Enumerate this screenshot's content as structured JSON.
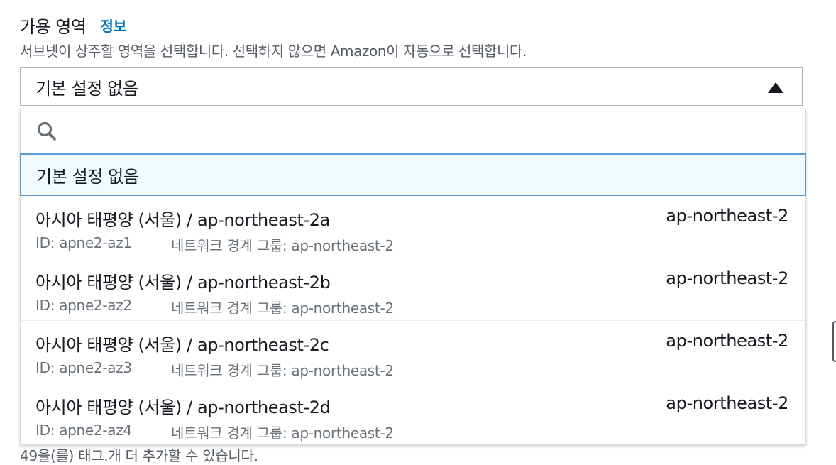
{
  "field": {
    "label": "가용 영역",
    "info_link": "정보",
    "description": "서브넷이 상주할 영역을 선택합니다. 선택하지 않으면 Amazon이 자동으로 선택합니다."
  },
  "select": {
    "value": "기본 설정 없음",
    "expanded": true
  },
  "search": {
    "placeholder": "",
    "value": ""
  },
  "options": {
    "default_label": "기본 설정 없음",
    "zones": [
      {
        "name": "아시아 태평양 (서울) / ap-northeast-2a",
        "region": "ap-northeast-2",
        "id": "ID: apne2-az1",
        "group": "네트워크 경계 그룹: ap-northeast-2"
      },
      {
        "name": "아시아 태평양 (서울) / ap-northeast-2b",
        "region": "ap-northeast-2",
        "id": "ID: apne2-az2",
        "group": "네트워크 경계 그룹: ap-northeast-2"
      },
      {
        "name": "아시아 태평양 (서울) / ap-northeast-2c",
        "region": "ap-northeast-2",
        "id": "ID: apne2-az3",
        "group": "네트워크 경계 그룹: ap-northeast-2"
      },
      {
        "name": "아시아 태평양 (서울) / ap-northeast-2d",
        "region": "ap-northeast-2",
        "id": "ID: apne2-az4",
        "group": "네트워크 경계 그룹: ap-northeast-2"
      }
    ]
  },
  "footer": {
    "text": "49을(를) 태그.개 더 추가할 수 있습니다."
  },
  "colors": {
    "link": "#0073bb",
    "selected_border": "#5a9bd4",
    "selected_bg": "#f1faff",
    "secondary_text": "#687078"
  },
  "icons": {
    "search": "search-icon",
    "caret": "caret-up-icon"
  }
}
